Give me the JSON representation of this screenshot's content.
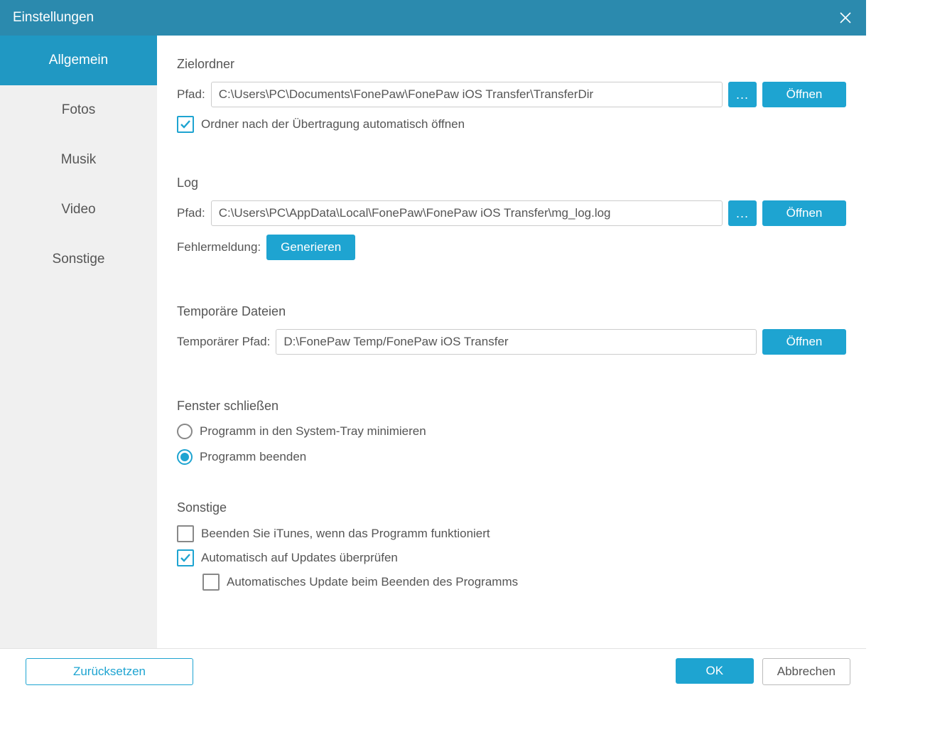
{
  "window": {
    "title": "Einstellungen"
  },
  "sidebar": {
    "items": [
      {
        "label": "Allgemein",
        "active": true
      },
      {
        "label": "Fotos",
        "active": false
      },
      {
        "label": "Musik",
        "active": false
      },
      {
        "label": "Video",
        "active": false
      },
      {
        "label": "Sonstige",
        "active": false
      }
    ]
  },
  "target_folder": {
    "heading": "Zielordner",
    "path_label": "Pfad:",
    "path_value": "C:\\Users\\PC\\Documents\\FonePaw\\FonePaw iOS Transfer\\TransferDir",
    "browse_label": "...",
    "open_label": "Öffnen",
    "auto_open_label": "Ordner nach der Übertragung automatisch öffnen",
    "auto_open_checked": true
  },
  "log": {
    "heading": "Log",
    "path_label": "Pfad:",
    "path_value": "C:\\Users\\PC\\AppData\\Local\\FonePaw\\FonePaw iOS Transfer\\mg_log.log",
    "browse_label": "...",
    "open_label": "Öffnen",
    "error_label": "Fehlermeldung:",
    "generate_label": "Generieren"
  },
  "temp": {
    "heading": "Temporäre Dateien",
    "path_label": "Temporärer Pfad:",
    "path_value": "D:\\FonePaw Temp/FonePaw iOS Transfer",
    "open_label": "Öffnen"
  },
  "close_window": {
    "heading": "Fenster schließen",
    "option_minimize": "Programm in den System-Tray minimieren",
    "option_exit": "Programm beenden",
    "selected": "exit"
  },
  "other": {
    "heading": "Sonstige",
    "close_itunes_label": "Beenden Sie iTunes, wenn das Programm funktioniert",
    "close_itunes_checked": false,
    "auto_update_label": "Automatisch auf Updates überprüfen",
    "auto_update_checked": true,
    "auto_update_on_exit_label": "Automatisches Update beim Beenden des Programms",
    "auto_update_on_exit_checked": false
  },
  "footer": {
    "reset_label": "Zurücksetzen",
    "ok_label": "OK",
    "cancel_label": "Abbrechen"
  }
}
